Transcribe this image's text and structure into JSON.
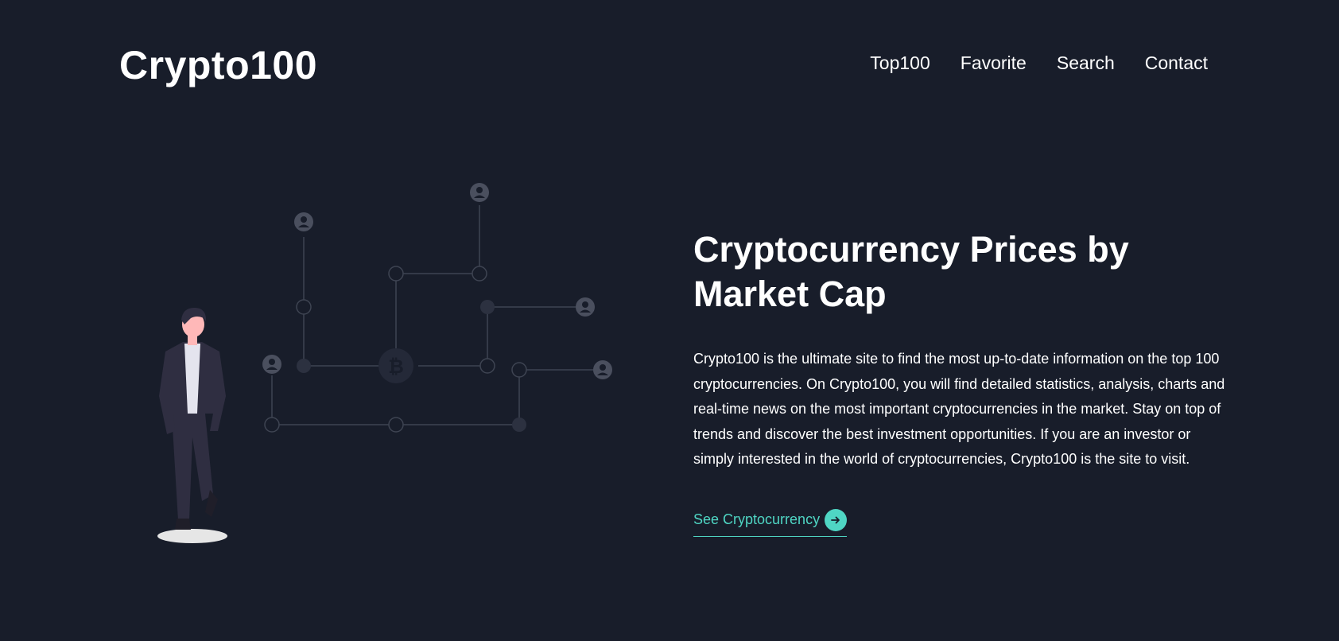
{
  "header": {
    "logo": "Crypto100",
    "nav": [
      {
        "label": "Top100"
      },
      {
        "label": "Favorite"
      },
      {
        "label": "Search"
      },
      {
        "label": "Contact"
      }
    ]
  },
  "hero": {
    "title": "Cryptocurrency Prices by Market Cap",
    "description": "Crypto100 is the ultimate site to find the most up-to-date information on the top 100 cryptocurrencies. On Crypto100, you will find detailed statistics, analysis, charts and real-time news on the most important cryptocurrencies in the market. Stay on top of trends and discover the best investment opportunities. If you are an investor or simply interested in the world of cryptocurrencies, Crypto100 is the site to visit.",
    "cta_label": "See Cryptocurrency"
  },
  "colors": {
    "background": "#181d2a",
    "accent": "#4fd6c4",
    "network_line": "#3e4452",
    "node_fill": "#2c3140",
    "user_icon": "#4a4f5e"
  },
  "icons": {
    "cta": "arrow-right-icon",
    "network_center": "bitcoin-icon",
    "network_users": "user-icon"
  }
}
